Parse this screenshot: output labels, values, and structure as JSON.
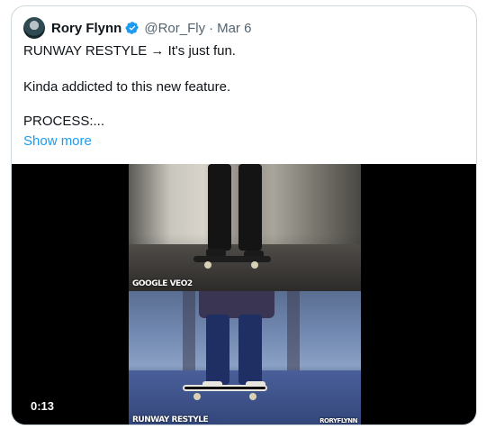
{
  "tweet": {
    "author_name": "Rory Flynn",
    "handle": "@Ror_Fly",
    "separator": "·",
    "date": "Mar 6",
    "text_line1": "RUNWAY RESTYLE → It's just fun.",
    "text_line2": "Kinda addicted to this new feature.",
    "text_line3": "PROCESS:...",
    "show_more": "Show more"
  },
  "media": {
    "duration": "0:13",
    "watermark_top": "GOOGLE VEO2",
    "watermark_bottom_left": "RUNWAY RESTYLE",
    "watermark_bottom_right": "RORYFLYNN"
  },
  "icons": {
    "verified": "verified-badge-icon"
  },
  "colors": {
    "link": "#1d9bf0",
    "secondary_text": "#536471",
    "border": "#cfd9de"
  }
}
